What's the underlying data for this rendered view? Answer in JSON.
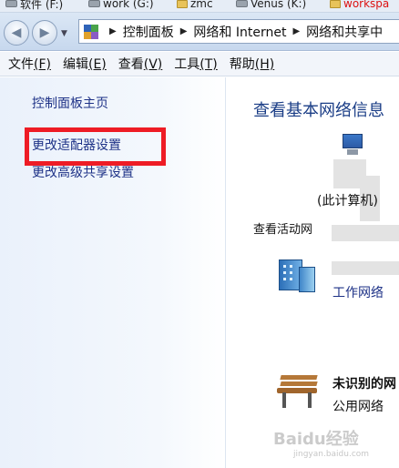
{
  "topbar": {
    "items": [
      "软件 (F:)",
      "work (G:)",
      "zmc",
      "Venus (K:)",
      "workspa"
    ]
  },
  "address": {
    "segments": [
      "控制面板",
      "网络和 Internet",
      "网络和共享中"
    ]
  },
  "menu": {
    "items": [
      {
        "label": "文件",
        "key": "(F)"
      },
      {
        "label": "编辑",
        "key": "(E)"
      },
      {
        "label": "查看",
        "key": "(V)"
      },
      {
        "label": "工具",
        "key": "(T)"
      },
      {
        "label": "帮助",
        "key": "(H)"
      }
    ]
  },
  "left": {
    "home": "控制面板主页",
    "adapter": "更改适配器设置",
    "sharing": "更改高级共享设置"
  },
  "right": {
    "title": "查看基本网络信息",
    "this_computer": "(此计算机)",
    "active_networks": "查看活动网",
    "work_network": "工作网络",
    "unknown_network": "未识别的网",
    "public_network": "公用网络"
  },
  "watermark": {
    "text": "Baidu经验",
    "url": "jingyan.baidu.com"
  },
  "colors": {
    "link": "#1e3287",
    "title": "#1a3d86",
    "highlight": "#ee1c25"
  }
}
